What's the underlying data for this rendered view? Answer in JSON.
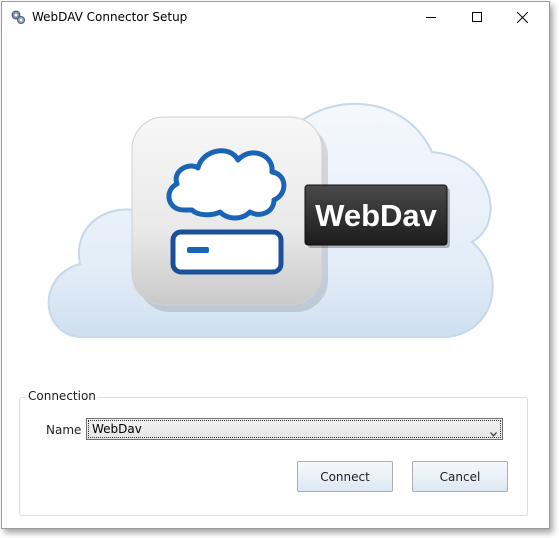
{
  "window": {
    "title": "WebDAV Connector Setup",
    "controls": {
      "minimize": "minimize-icon",
      "maximize": "maximize-icon",
      "close": "close-icon"
    }
  },
  "hero": {
    "logo_text": "WebDav",
    "icons": [
      "cloud-icon",
      "server-icon"
    ],
    "colors": {
      "cloud_accent": "#1a64b5",
      "badge_bg": "#2b2b2b",
      "badge_text": "#ffffff"
    }
  },
  "connection": {
    "legend": "Connection",
    "name_label": "Name",
    "name_value": "WebDav",
    "connect_label": "Connect",
    "cancel_label": "Cancel"
  }
}
